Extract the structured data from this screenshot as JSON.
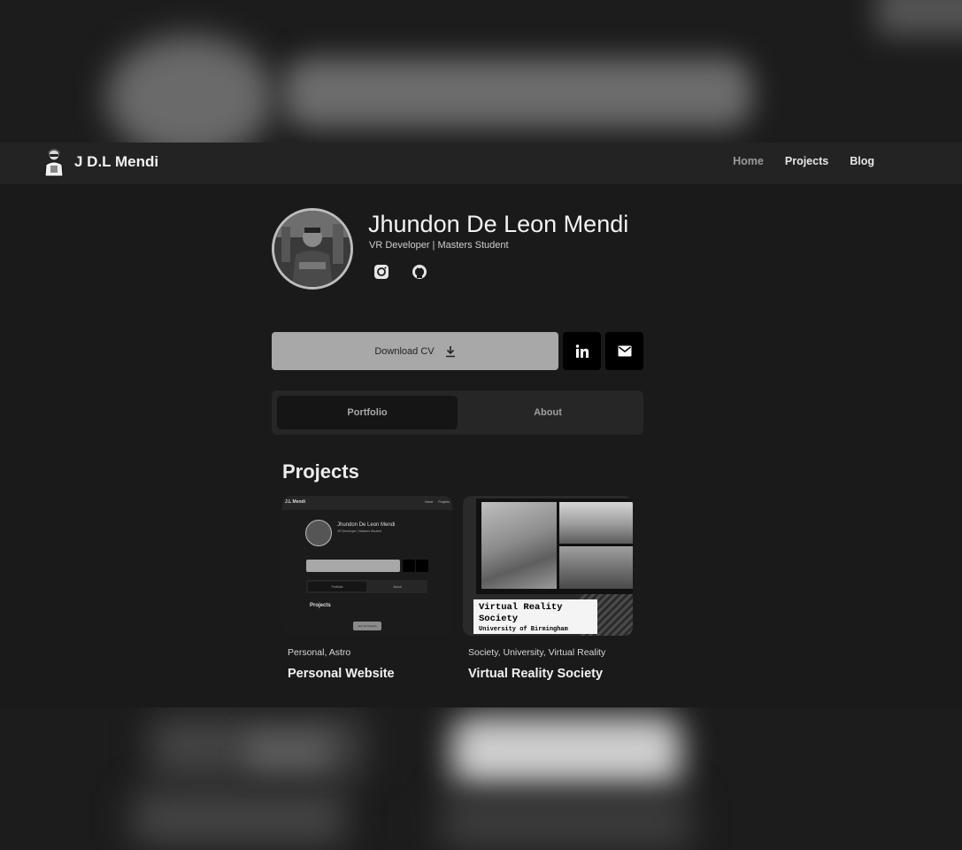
{
  "header": {
    "brand_name": "J D.L Mendi",
    "brand_logo_icon": "cartoon-avatar-icon",
    "nav": [
      {
        "label": "Home"
      },
      {
        "label": "Projects"
      },
      {
        "label": "Blog"
      }
    ]
  },
  "profile": {
    "name": "Jhundon De Leon Mendi",
    "subtitle": "VR Developer | Masters Student",
    "social_icons": [
      "instagram-icon",
      "github-icon"
    ]
  },
  "actions": {
    "download_cv_label": "Download CV",
    "download_icon": "download-icon",
    "linkedin_icon": "linkedin-icon",
    "email_icon": "mail-icon"
  },
  "tabs": [
    {
      "label": "Portfolio",
      "active": true
    },
    {
      "label": "About",
      "active": false
    }
  ],
  "projects": {
    "title": "Projects",
    "items": [
      {
        "tags": "Personal, Astro",
        "title": "Personal Website",
        "thumb": {
          "brand": "J.L Mendi",
          "nav": [
            "Home",
            "Projects"
          ],
          "name": "Jhundon De Leon Mendi",
          "subtitle": "VR Developer | Masters Student",
          "tab1": "Portfolio",
          "tab2": "About",
          "section": "Projects",
          "button": "See All Projects"
        }
      },
      {
        "tags": "Society, University, Virtual Reality",
        "title": "Virtual Reality Society",
        "thumb": {
          "label_line1": "Virtual Reality",
          "label_line2": "Society",
          "label_line3": "University of Birmingham"
        }
      }
    ]
  },
  "colors": {
    "page_bg": "#1a1a1a",
    "navbar_bg": "#232323",
    "cv_button_bg": "#a8a8a8",
    "icon_button_bg": "#000000"
  }
}
